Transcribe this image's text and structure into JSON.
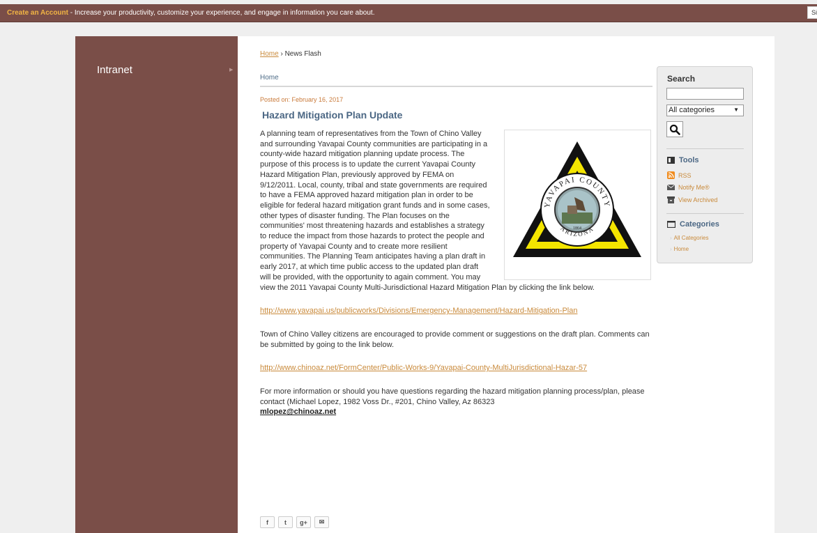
{
  "topbar": {
    "cta": "Create an Account",
    "message": " - Increase your productivity, customize your experience, and engage in information you care about.",
    "sign_in": "Si"
  },
  "sidebar": {
    "items": [
      {
        "label": "Intranet",
        "arrow": "▶"
      }
    ]
  },
  "breadcrumb": {
    "home": "Home",
    "separator": " › ",
    "current": "News Flash"
  },
  "section": {
    "label": "Home"
  },
  "article": {
    "posted": "Posted on: February 16, 2017",
    "title": "Hazard Mitigation Plan Update",
    "paragraph1": "A planning team of representatives from the Town of Chino Valley and surrounding Yavapai County communities are participating in a county-wide hazard mitigation planning update process. The purpose of this process is to update the current Yavapai County Hazard Mitigation Plan, previously approved by FEMA on 9/12/2011. Local, county, tribal and state governments are required to have a FEMA approved hazard mitigation plan in order to be eligible for federal hazard mitigation grant funds and in some cases, other types of disaster funding. The Plan focuses on the communities' most threatening hazards and establishes a strategy to reduce the impact from those hazards to protect the people and property of Yavapai County and to create more resilient communities. The Planning Team anticipates having a plan draft in early 2017, at which time public access to the updated plan draft will be provided, with the opportunity to again comment. You may view the 2011 Yavapai County Multi-Jurisdictional Hazard Mitigation Plan by clicking the link below.",
    "link1": "http://www.yavapai.us/publicworks/Divisions/Emergency-Management/Hazard-Mitigation-Plan",
    "paragraph2": "Town of Chino Valley citizens are encouraged to provide comment or suggestions on the draft plan.  Comments can be submitted by going to the link below.",
    "link2": "http://www.chinoaz.net/FormCenter/Public-Works-9/Yavapai-County-MultiJurisdictional-Hazar-57",
    "paragraph3": "For more information or should you have questions regarding the hazard mitigation planning process/plan, please contact (Michael Lopez, 1982 Voss Dr., #201, Chino Valley, Az 86323",
    "email": "mlopez@chinoaz.net",
    "seal": {
      "top_text": "YAVAPAI COUNTY",
      "bottom_text": "ARIZONA",
      "year": "1864"
    }
  },
  "social": [
    {
      "icon": "facebook-icon",
      "glyph": "f"
    },
    {
      "icon": "twitter-icon",
      "glyph": "t"
    },
    {
      "icon": "google-plus-icon",
      "glyph": "g+"
    },
    {
      "icon": "email-icon",
      "glyph": "✉"
    }
  ],
  "right_panel": {
    "search_title": "Search",
    "search_value": "",
    "category_selected": "All categories",
    "tools_title": "Tools",
    "tools": [
      {
        "label": "RSS",
        "icon": "rss-icon"
      },
      {
        "label": "Notify Me®",
        "icon": "envelope-icon"
      },
      {
        "label": "View Archived",
        "icon": "archive-icon"
      }
    ],
    "categories_title": "Categories",
    "categories": [
      {
        "label": "All Categories"
      },
      {
        "label": "Home"
      }
    ]
  },
  "colors": {
    "brand": "#7a4e48",
    "accent": "#f2b544",
    "link": "#c98a3b",
    "heading": "#4b6784"
  }
}
